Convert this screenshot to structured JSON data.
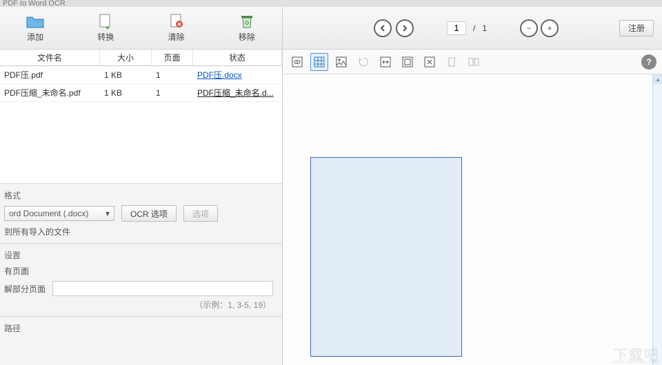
{
  "titlebar": "PDF to Word OCR",
  "toolbar": {
    "add": "添加",
    "convert": "转换",
    "clear": "清除",
    "remove": "移除"
  },
  "table": {
    "headers": {
      "name": "文件名",
      "size": "大小",
      "page": "页面",
      "status": "状态"
    },
    "rows": [
      {
        "name": "PDF压.pdf",
        "size": "1 KB",
        "page": "1",
        "status": "PDF压.docx"
      },
      {
        "name": "PDF压缩_未命名.pdf",
        "size": "1 KB",
        "page": "1",
        "status": "PDF压缩_未命名.d..."
      }
    ]
  },
  "format": {
    "title": "格式",
    "selected": "ord Document (.docx)",
    "ocr_btn": "OCR 选项",
    "opt_btn": "选项",
    "apply_all": "到所有导入的文件"
  },
  "settings": {
    "title": "设置",
    "all_pages": "有页面",
    "partial_pages": "解部分页面",
    "example": "（示例：1, 3-5, 19）"
  },
  "path": {
    "title": "路径"
  },
  "nav": {
    "page_current": "1",
    "page_sep": "/",
    "page_total": "1"
  },
  "register_btn": "注册",
  "watermark": "下载吧",
  "watermark_sub": "www.xiazaiba.com"
}
